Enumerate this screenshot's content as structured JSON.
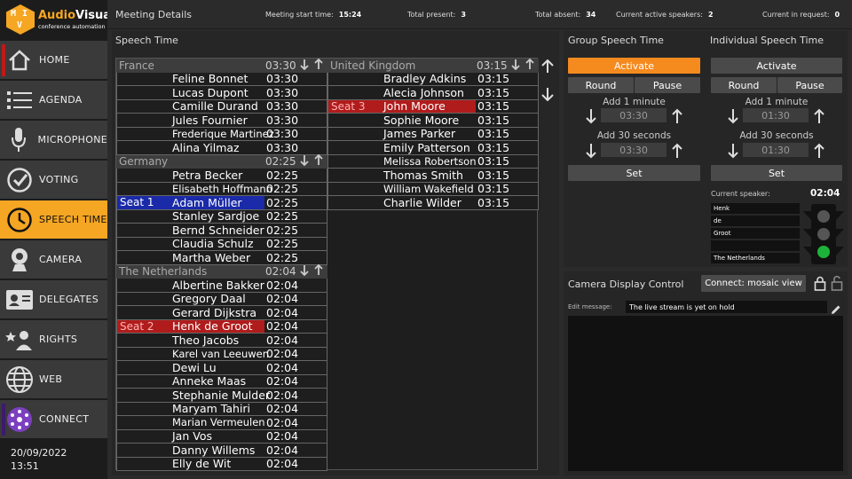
{
  "logo": {
    "letters": [
      "M",
      "I",
      "V"
    ],
    "title_a": "Audio",
    "title_b": "Visual",
    "subtitle": "conference automation"
  },
  "nav": [
    {
      "label": "HOME",
      "icon": "home-icon"
    },
    {
      "label": "AGENDA",
      "icon": "list-icon"
    },
    {
      "label": "MICROPHONE",
      "icon": "microphone-icon"
    },
    {
      "label": "VOTING",
      "icon": "check-circle-icon"
    },
    {
      "label": "SPEECH TIME",
      "icon": "clock-icon"
    },
    {
      "label": "CAMERA",
      "icon": "webcam-icon"
    },
    {
      "label": "DELEGATES",
      "icon": "id-card-icon"
    },
    {
      "label": "RIGHTS",
      "icon": "user-star-icon"
    },
    {
      "label": "WEB",
      "icon": "globe-icon"
    },
    {
      "label": "CONNECT",
      "icon": "connect-icon"
    }
  ],
  "active_nav": "SPEECH TIME",
  "datetime": {
    "date": "20/09/2022",
    "time": "13:51"
  },
  "meeting": {
    "title": "Meeting Details",
    "start_label": "Meeting start time:",
    "start_value": "15:24",
    "present_label": "Total present:",
    "present_value": "3",
    "absent_label": "Total absent:",
    "absent_value": "34",
    "active_label": "Current active speakers:",
    "active_value": "2",
    "request_label": "Current in request:",
    "request_value": "0"
  },
  "speech_time": {
    "title": "Speech Time",
    "columns": [
      [
        {
          "group": "France",
          "time": "03:30",
          "members": [
            {
              "name": "Feline Bonnet",
              "time": "03:30"
            },
            {
              "name": "Lucas Dupont",
              "time": "03:30"
            },
            {
              "name": "Camille Durand",
              "time": "03:30"
            },
            {
              "name": "Jules Fournier",
              "time": "03:30"
            },
            {
              "name": "Frederique Martinez",
              "time": "03:30",
              "small": true
            },
            {
              "name": "Alina Yilmaz",
              "time": "03:30"
            }
          ]
        },
        {
          "group": "Germany",
          "time": "02:25",
          "members": [
            {
              "name": "Petra Becker",
              "time": "02:25"
            },
            {
              "name": "Elisabeth Hoffmann",
              "time": "02:25",
              "small": true
            },
            {
              "name": "Adam Müller",
              "time": "02:25",
              "seat": "Seat 1",
              "seat_color": "blue"
            },
            {
              "name": "Stanley Sardjoe",
              "time": "02:25"
            },
            {
              "name": "Bernd Schneider",
              "time": "02:25"
            },
            {
              "name": "Claudia Schulz",
              "time": "02:25"
            },
            {
              "name": "Martha Weber",
              "time": "02:25"
            }
          ]
        },
        {
          "group": "The Netherlands",
          "time": "02:04",
          "members": [
            {
              "name": "Albertine Bakker",
              "time": "02:04"
            },
            {
              "name": "Gregory Daal",
              "time": "02:04"
            },
            {
              "name": "Gerard Dijkstra",
              "time": "02:04"
            },
            {
              "name": "Henk de Groot",
              "time": "02:04",
              "seat": "Seat 2",
              "seat_color": "red"
            },
            {
              "name": "Theo Jacobs",
              "time": "02:04"
            },
            {
              "name": "Karel van Leeuwen",
              "time": "02:04",
              "small": true
            },
            {
              "name": "Dewi Lu",
              "time": "02:04"
            },
            {
              "name": "Anneke Maas",
              "time": "02:04"
            },
            {
              "name": "Stephanie Mulder",
              "time": "02:04"
            },
            {
              "name": "Maryam Tahiri",
              "time": "02:04"
            },
            {
              "name": "Marian Vermeulen",
              "time": "02:04",
              "small": true
            },
            {
              "name": "Jan Vos",
              "time": "02:04"
            },
            {
              "name": "Danny Willems",
              "time": "02:04"
            },
            {
              "name": "Elly de Wit",
              "time": "02:04"
            }
          ]
        }
      ],
      [
        {
          "group": "United Kingdom",
          "time": "03:15",
          "members": [
            {
              "name": "Bradley Adkins",
              "time": "03:15"
            },
            {
              "name": "Alecia Johnson",
              "time": "03:15"
            },
            {
              "name": "John Moore",
              "time": "03:15",
              "seat": "Seat 3",
              "seat_color": "red"
            },
            {
              "name": "Sophie Moore",
              "time": "03:15"
            },
            {
              "name": "James Parker",
              "time": "03:15"
            },
            {
              "name": "Emily Patterson",
              "time": "03:15"
            },
            {
              "name": "Melissa Robertson",
              "time": "03:15",
              "small": true
            },
            {
              "name": "Thomas Smith",
              "time": "03:15"
            },
            {
              "name": "William Wakefield",
              "time": "03:15",
              "small": true
            },
            {
              "name": "Charlie Wilder",
              "time": "03:15"
            }
          ]
        }
      ]
    ]
  },
  "group_speech": {
    "title": "Group Speech Time",
    "activate": "Activate",
    "round": "Round",
    "pause": "Pause",
    "add1_label": "Add 1 minute",
    "add1_value": "03:30",
    "add30_label": "Add 30 seconds",
    "add30_value": "03:30",
    "set": "Set"
  },
  "individual_speech": {
    "title": "Individual Speech Time",
    "activate": "Activate",
    "round": "Round",
    "pause": "Pause",
    "add1_label": "Add 1 minute",
    "add1_value": "01:30",
    "add30_label": "Add 30 seconds",
    "add30_value": "01:30",
    "set": "Set",
    "current_label": "Current speaker:",
    "current_time": "02:04",
    "speaker_fields": [
      "Henk",
      "de",
      "Groot",
      "",
      "The Netherlands"
    ]
  },
  "camera": {
    "title": "Camera Display Control",
    "connect_button": "Connect: mosaic view",
    "edit_label": "Edit message:",
    "message": "The live stream is yet on hold"
  },
  "colors": {
    "accent": "#f5a623",
    "activate": "#f58a1f",
    "seat_red": "#b01c1c",
    "seat_blue": "#1a2aa8",
    "light_green": "#1db33a"
  }
}
